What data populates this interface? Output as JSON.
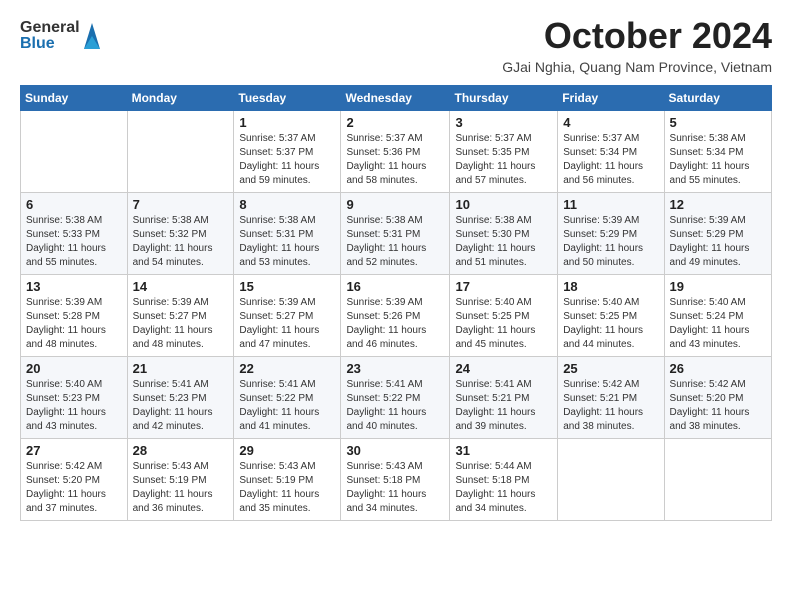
{
  "header": {
    "logo": {
      "general": "General",
      "blue": "Blue"
    },
    "title": "October 2024",
    "location": "GJai Nghia, Quang Nam Province, Vietnam"
  },
  "days_of_week": [
    "Sunday",
    "Monday",
    "Tuesday",
    "Wednesday",
    "Thursday",
    "Friday",
    "Saturday"
  ],
  "weeks": [
    [
      {
        "day": "",
        "sunrise": "",
        "sunset": "",
        "daylight": ""
      },
      {
        "day": "",
        "sunrise": "",
        "sunset": "",
        "daylight": ""
      },
      {
        "day": "1",
        "sunrise": "Sunrise: 5:37 AM",
        "sunset": "Sunset: 5:37 PM",
        "daylight": "Daylight: 11 hours and 59 minutes."
      },
      {
        "day": "2",
        "sunrise": "Sunrise: 5:37 AM",
        "sunset": "Sunset: 5:36 PM",
        "daylight": "Daylight: 11 hours and 58 minutes."
      },
      {
        "day": "3",
        "sunrise": "Sunrise: 5:37 AM",
        "sunset": "Sunset: 5:35 PM",
        "daylight": "Daylight: 11 hours and 57 minutes."
      },
      {
        "day": "4",
        "sunrise": "Sunrise: 5:37 AM",
        "sunset": "Sunset: 5:34 PM",
        "daylight": "Daylight: 11 hours and 56 minutes."
      },
      {
        "day": "5",
        "sunrise": "Sunrise: 5:38 AM",
        "sunset": "Sunset: 5:34 PM",
        "daylight": "Daylight: 11 hours and 55 minutes."
      }
    ],
    [
      {
        "day": "6",
        "sunrise": "Sunrise: 5:38 AM",
        "sunset": "Sunset: 5:33 PM",
        "daylight": "Daylight: 11 hours and 55 minutes."
      },
      {
        "day": "7",
        "sunrise": "Sunrise: 5:38 AM",
        "sunset": "Sunset: 5:32 PM",
        "daylight": "Daylight: 11 hours and 54 minutes."
      },
      {
        "day": "8",
        "sunrise": "Sunrise: 5:38 AM",
        "sunset": "Sunset: 5:31 PM",
        "daylight": "Daylight: 11 hours and 53 minutes."
      },
      {
        "day": "9",
        "sunrise": "Sunrise: 5:38 AM",
        "sunset": "Sunset: 5:31 PM",
        "daylight": "Daylight: 11 hours and 52 minutes."
      },
      {
        "day": "10",
        "sunrise": "Sunrise: 5:38 AM",
        "sunset": "Sunset: 5:30 PM",
        "daylight": "Daylight: 11 hours and 51 minutes."
      },
      {
        "day": "11",
        "sunrise": "Sunrise: 5:39 AM",
        "sunset": "Sunset: 5:29 PM",
        "daylight": "Daylight: 11 hours and 50 minutes."
      },
      {
        "day": "12",
        "sunrise": "Sunrise: 5:39 AM",
        "sunset": "Sunset: 5:29 PM",
        "daylight": "Daylight: 11 hours and 49 minutes."
      }
    ],
    [
      {
        "day": "13",
        "sunrise": "Sunrise: 5:39 AM",
        "sunset": "Sunset: 5:28 PM",
        "daylight": "Daylight: 11 hours and 48 minutes."
      },
      {
        "day": "14",
        "sunrise": "Sunrise: 5:39 AM",
        "sunset": "Sunset: 5:27 PM",
        "daylight": "Daylight: 11 hours and 48 minutes."
      },
      {
        "day": "15",
        "sunrise": "Sunrise: 5:39 AM",
        "sunset": "Sunset: 5:27 PM",
        "daylight": "Daylight: 11 hours and 47 minutes."
      },
      {
        "day": "16",
        "sunrise": "Sunrise: 5:39 AM",
        "sunset": "Sunset: 5:26 PM",
        "daylight": "Daylight: 11 hours and 46 minutes."
      },
      {
        "day": "17",
        "sunrise": "Sunrise: 5:40 AM",
        "sunset": "Sunset: 5:25 PM",
        "daylight": "Daylight: 11 hours and 45 minutes."
      },
      {
        "day": "18",
        "sunrise": "Sunrise: 5:40 AM",
        "sunset": "Sunset: 5:25 PM",
        "daylight": "Daylight: 11 hours and 44 minutes."
      },
      {
        "day": "19",
        "sunrise": "Sunrise: 5:40 AM",
        "sunset": "Sunset: 5:24 PM",
        "daylight": "Daylight: 11 hours and 43 minutes."
      }
    ],
    [
      {
        "day": "20",
        "sunrise": "Sunrise: 5:40 AM",
        "sunset": "Sunset: 5:23 PM",
        "daylight": "Daylight: 11 hours and 43 minutes."
      },
      {
        "day": "21",
        "sunrise": "Sunrise: 5:41 AM",
        "sunset": "Sunset: 5:23 PM",
        "daylight": "Daylight: 11 hours and 42 minutes."
      },
      {
        "day": "22",
        "sunrise": "Sunrise: 5:41 AM",
        "sunset": "Sunset: 5:22 PM",
        "daylight": "Daylight: 11 hours and 41 minutes."
      },
      {
        "day": "23",
        "sunrise": "Sunrise: 5:41 AM",
        "sunset": "Sunset: 5:22 PM",
        "daylight": "Daylight: 11 hours and 40 minutes."
      },
      {
        "day": "24",
        "sunrise": "Sunrise: 5:41 AM",
        "sunset": "Sunset: 5:21 PM",
        "daylight": "Daylight: 11 hours and 39 minutes."
      },
      {
        "day": "25",
        "sunrise": "Sunrise: 5:42 AM",
        "sunset": "Sunset: 5:21 PM",
        "daylight": "Daylight: 11 hours and 38 minutes."
      },
      {
        "day": "26",
        "sunrise": "Sunrise: 5:42 AM",
        "sunset": "Sunset: 5:20 PM",
        "daylight": "Daylight: 11 hours and 38 minutes."
      }
    ],
    [
      {
        "day": "27",
        "sunrise": "Sunrise: 5:42 AM",
        "sunset": "Sunset: 5:20 PM",
        "daylight": "Daylight: 11 hours and 37 minutes."
      },
      {
        "day": "28",
        "sunrise": "Sunrise: 5:43 AM",
        "sunset": "Sunset: 5:19 PM",
        "daylight": "Daylight: 11 hours and 36 minutes."
      },
      {
        "day": "29",
        "sunrise": "Sunrise: 5:43 AM",
        "sunset": "Sunset: 5:19 PM",
        "daylight": "Daylight: 11 hours and 35 minutes."
      },
      {
        "day": "30",
        "sunrise": "Sunrise: 5:43 AM",
        "sunset": "Sunset: 5:18 PM",
        "daylight": "Daylight: 11 hours and 34 minutes."
      },
      {
        "day": "31",
        "sunrise": "Sunrise: 5:44 AM",
        "sunset": "Sunset: 5:18 PM",
        "daylight": "Daylight: 11 hours and 34 minutes."
      },
      {
        "day": "",
        "sunrise": "",
        "sunset": "",
        "daylight": ""
      },
      {
        "day": "",
        "sunrise": "",
        "sunset": "",
        "daylight": ""
      }
    ]
  ]
}
